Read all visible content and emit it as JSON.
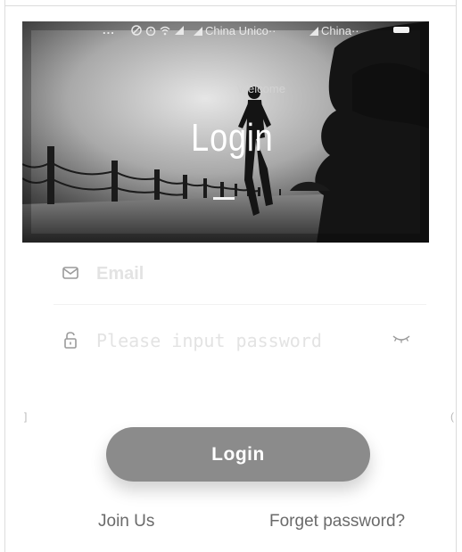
{
  "status_bar": {
    "dots": "...",
    "carrier_1": "China Unico··",
    "carrier_2": "China··"
  },
  "hero": {
    "welcome": "Welcome",
    "title": "Login"
  },
  "form": {
    "email_placeholder": "Email",
    "email_value": "",
    "password_placeholder": "Please input password",
    "password_value": ""
  },
  "side_marks": {
    "left": "]",
    "right": "("
  },
  "actions": {
    "login_label": "Login",
    "join_label": "Join Us",
    "forget_label": "Forget password?"
  },
  "icons": {
    "email": "envelope-icon",
    "password": "lock-icon",
    "visibility": "eye-closed-icon"
  },
  "colors": {
    "login_button": "#8b8b8b",
    "link_text": "#6a6a6a",
    "placeholder": "#e3e3e3"
  }
}
